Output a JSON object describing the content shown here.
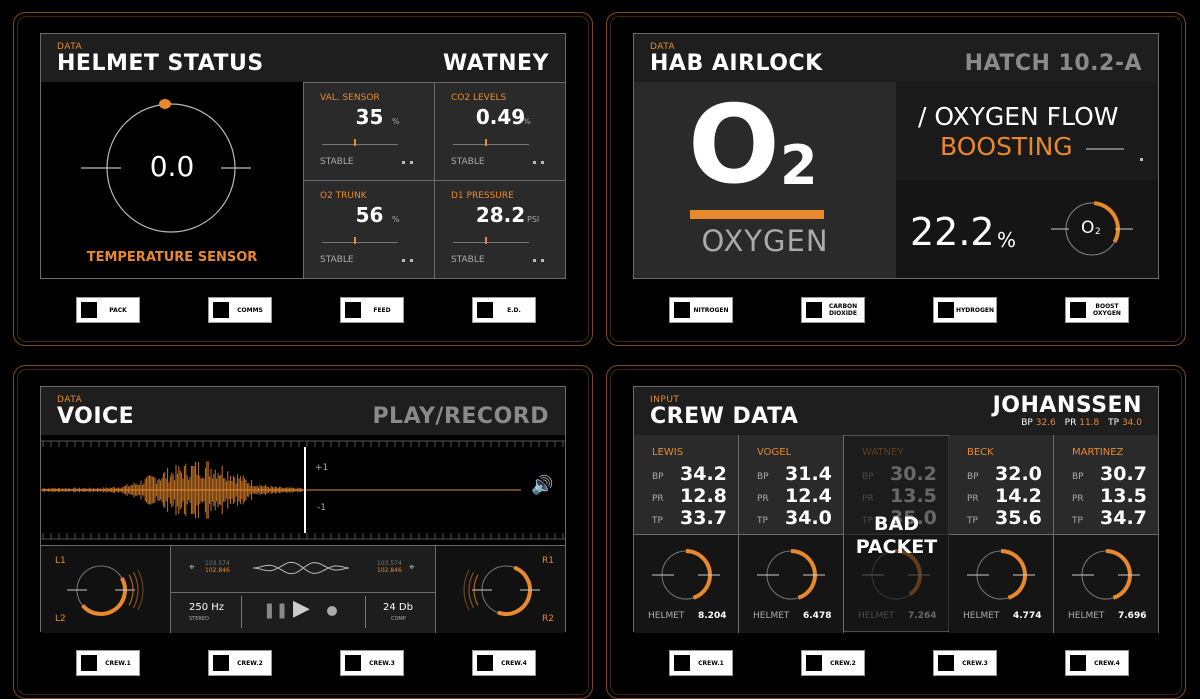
{
  "helmet": {
    "tag": "DATA",
    "title": "HELMET STATUS",
    "right": "WATNEY",
    "gauge_value": "0.0",
    "gauge_label": "TEMPERATURE SENSOR",
    "sensors": [
      {
        "label": "VAL. SENSOR",
        "value": "35",
        "unit": "%",
        "status": "STABLE"
      },
      {
        "label": "CO2 LEVELS",
        "value": "0.49",
        "unit": "%",
        "status": "STABLE"
      },
      {
        "label": "O2 TRUNK",
        "value": "56",
        "unit": "%",
        "status": "STABLE"
      },
      {
        "label": "D1 PRESSURE",
        "value": "28.2",
        "unit": "PSI",
        "status": "STABLE"
      }
    ],
    "buttons": [
      "PACK",
      "COMMS",
      "FEED",
      "E.D."
    ]
  },
  "airlock": {
    "tag": "DATA",
    "title": "HAB AIRLOCK",
    "right": "HATCH 10.2-A",
    "o2_symbol": "O",
    "o2_sub": "2",
    "o2_name": "OXYGEN",
    "flow_title": "/ OXYGEN FLOW",
    "flow_status": "BOOSTING",
    "percent": "22.2",
    "percent_unit": "%",
    "mini_symbol": "O",
    "mini_sub": "2",
    "buttons": [
      "NITROGEN",
      "CARBON DIOXIDE",
      "HYDROGEN",
      "BOOST OXYGEN"
    ]
  },
  "voice": {
    "tag": "DATA",
    "title": "VOICE",
    "right": "PLAY/RECORD",
    "scale_top": "+1",
    "scale_bottom": "-1",
    "ch_l1": "L1",
    "ch_l2": "L2",
    "ch_r1": "R1",
    "ch_r2": "R2",
    "freq_left_a": "103.574",
    "freq_left_b": "102.846",
    "freq_right_a": "103.574",
    "freq_right_b": "102.846",
    "hz": "250 Hz",
    "hz_sub": "STEREO",
    "db": "24 Db",
    "db_sub": "COMP",
    "buttons": [
      "CREW.1",
      "CREW.2",
      "CREW.3",
      "CREW.4"
    ]
  },
  "crew": {
    "tag": "INPUT",
    "title": "CREW DATA",
    "right": "JOHANSSEN",
    "vitals": {
      "bp_label": "BP",
      "bp": "32.6",
      "pr_label": "PR",
      "pr": "11.8",
      "tp_label": "TP",
      "tp": "34.0"
    },
    "members": [
      {
        "name": "LEWIS",
        "bp": "34.2",
        "pr": "12.8",
        "tp": "33.7",
        "helmet": "8.204",
        "arc": 0.45
      },
      {
        "name": "VOGEL",
        "bp": "31.4",
        "pr": "12.4",
        "tp": "34.0",
        "helmet": "6.478",
        "arc": 0.45
      },
      {
        "name": "WATNEY",
        "bp": "30.2",
        "pr": "13.5",
        "tp": "35.0",
        "helmet": "7.264",
        "arc": 0.4
      },
      {
        "name": "BECK",
        "bp": "32.0",
        "pr": "14.2",
        "tp": "35.6",
        "helmet": "4.774",
        "arc": 0.45
      },
      {
        "name": "MARTINEZ",
        "bp": "30.7",
        "pr": "13.5",
        "tp": "34.7",
        "helmet": "7.696",
        "arc": 0.45
      }
    ],
    "bad_packet_1": "BAD",
    "bad_packet_2": "PACKET",
    "labels": {
      "bp": "BP",
      "pr": "PR",
      "tp": "TP",
      "helmet": "HELMET"
    },
    "buttons": [
      "CREW.1",
      "CREW.2",
      "CREW.3",
      "CREW.4"
    ]
  },
  "colors": {
    "accent": "#e8892d",
    "panel": "#2a2a2a",
    "border": "#6a6a6a"
  }
}
